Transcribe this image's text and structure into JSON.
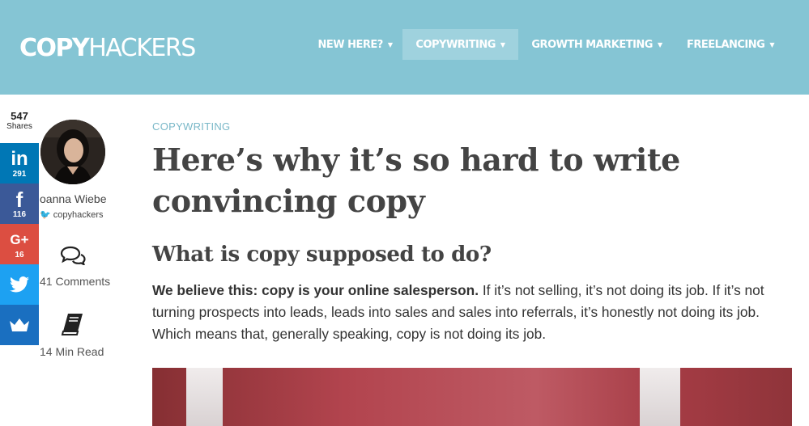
{
  "header": {
    "logo_part1": "COPY",
    "logo_part2": "HACKERS",
    "nav": [
      {
        "label": "NEW HERE?",
        "active": false
      },
      {
        "label": "COPYWRITING",
        "active": true
      },
      {
        "label": "GROWTH MARKETING",
        "active": false
      },
      {
        "label": "FREELANCING",
        "active": false
      }
    ],
    "caret": "▼"
  },
  "share": {
    "total": "547",
    "total_label": "Shares",
    "buttons": [
      {
        "network": "linkedin",
        "icon": "in",
        "count": "291",
        "color": "#0077b5"
      },
      {
        "network": "facebook",
        "icon": "f",
        "count": "116",
        "color": "#3b5998"
      },
      {
        "network": "googleplus",
        "icon": "G+",
        "count": "16",
        "color": "#dc4e41"
      },
      {
        "network": "twitter",
        "icon": "twitter-bird-icon",
        "count": "",
        "color": "#1da1f2"
      },
      {
        "network": "sumo",
        "icon": "crown-icon",
        "count": "",
        "color": "#1a6fc0"
      }
    ]
  },
  "author": {
    "name": "oanna Wiebe",
    "handle": "copyhackers",
    "comments": "41 Comments",
    "read_time": "14 Min Read"
  },
  "article": {
    "category": "COPYWRITING",
    "title": "Here’s why it’s so hard to write convincing copy",
    "subheading": "What is copy supposed to do?",
    "lead_bold": "We believe this: copy is your online salesperson.",
    "lead_rest": " If it’s not selling, it’s not doing its job. If it’s not turning prospects into leads, leads into sales and sales into referrals, it’s honestly not doing its job. Which means that, generally speaking, copy is not doing its job."
  },
  "colors": {
    "header_bg": "#85c5d4",
    "nav_active_bg": "#9fd2de",
    "category": "#7ab8c8",
    "heading": "#444444"
  }
}
